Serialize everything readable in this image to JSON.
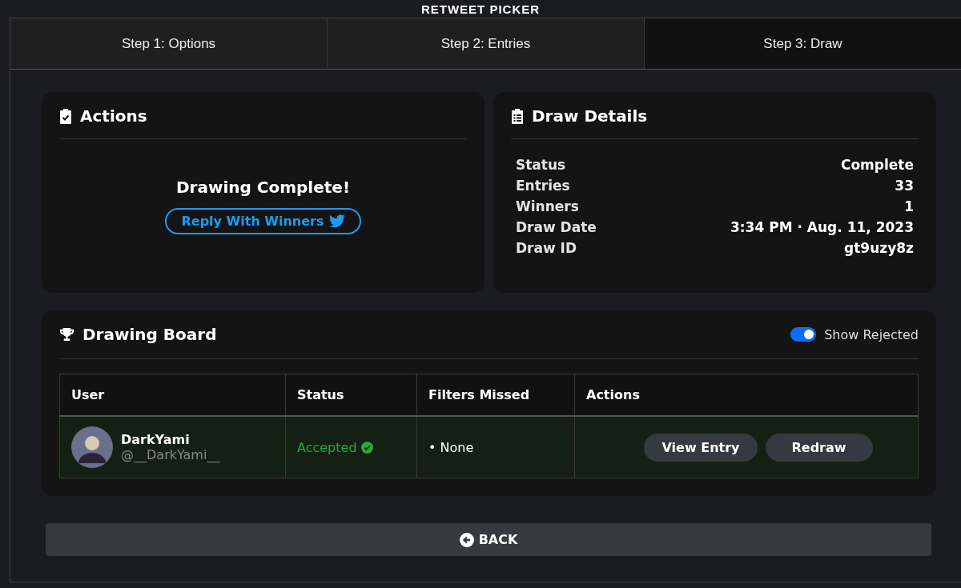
{
  "app_title": "RETWEET PICKER",
  "tabs": [
    {
      "label": "Step 1: Options",
      "selected": false
    },
    {
      "label": "Step 2: Entries",
      "selected": false
    },
    {
      "label": "Step 3: Draw",
      "selected": true
    }
  ],
  "actions": {
    "title": "Actions",
    "message": "Drawing Complete!",
    "button": "Reply With Winners"
  },
  "draw_details": {
    "title": "Draw Details",
    "rows": [
      {
        "label": "Status",
        "value": "Complete"
      },
      {
        "label": "Entries",
        "value": "33"
      },
      {
        "label": "Winners",
        "value": "1"
      },
      {
        "label": "Draw Date",
        "value": "3:34 PM · Aug. 11, 2023"
      },
      {
        "label": "Draw ID",
        "value": "gt9uzy8z"
      }
    ]
  },
  "drawing_board": {
    "title": "Drawing Board",
    "toggle": {
      "label": "Show Rejected",
      "on": true
    },
    "columns": [
      "User",
      "Status",
      "Filters Missed",
      "Actions"
    ],
    "rows": [
      {
        "name": "DarkYami",
        "handle": "@__DarkYami__",
        "status": "Accepted",
        "accepted": true,
        "filters_missed": "• None",
        "buttons": [
          "View Entry",
          "Redraw"
        ]
      }
    ]
  },
  "back_button": "BACK"
}
